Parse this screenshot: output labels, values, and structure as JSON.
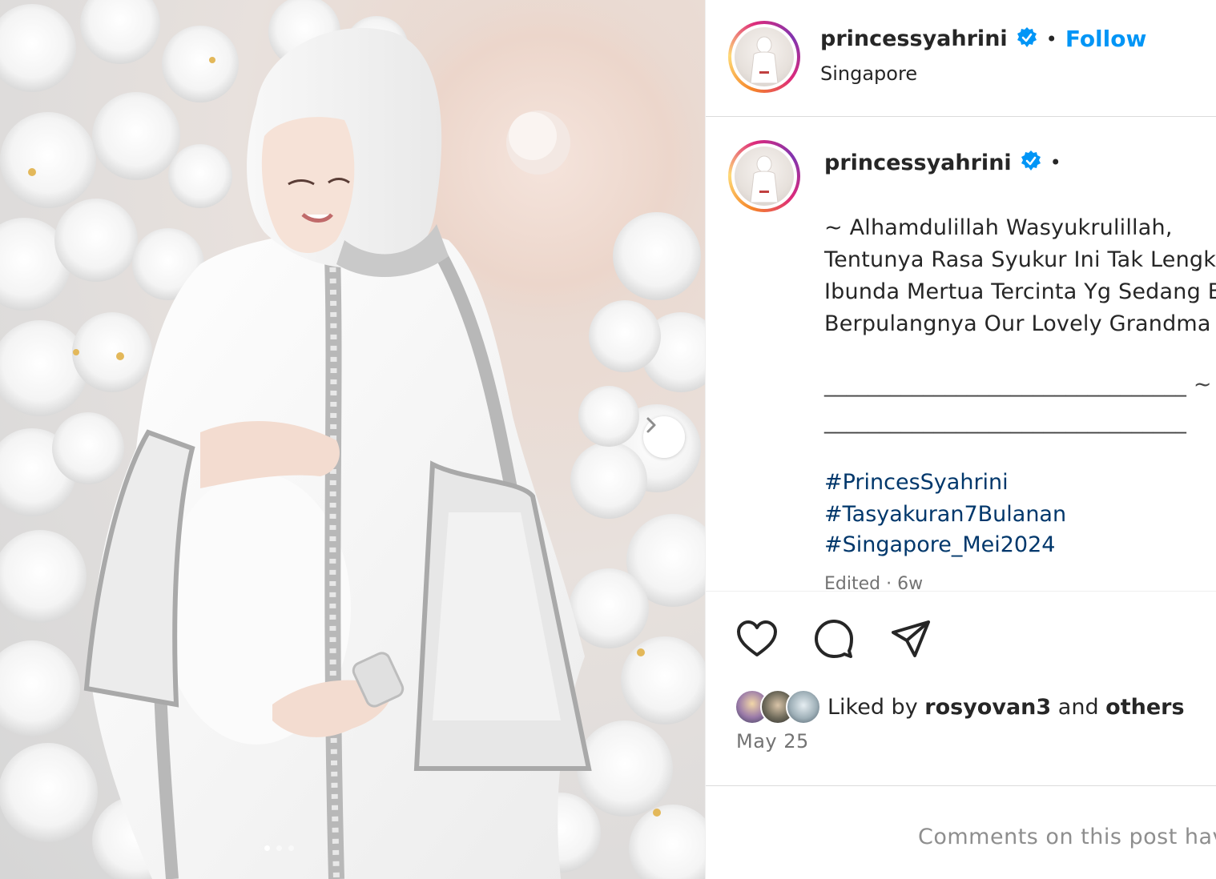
{
  "post": {
    "username": "princessyahrini",
    "bullet": "•",
    "follow_label": "Follow",
    "location": "Singapore"
  },
  "caption": {
    "username": "princessyahrini",
    "bullet": "•",
    "lines": [
      "~ Alhamdulillah Wasyukrulillah,",
      "Tentunya Rasa Syukur Ini Tak Lengka",
      "Ibunda Mertua Tercinta Yg Sedang B",
      "Berpulangnya Our Lovely Grandma K",
      "_________________________________ ~",
      "_________________________________"
    ],
    "hashtags": [
      "#PrincesSyahrini",
      "#Tasyakuran7Bulanan",
      "#Singapore_Mei2024"
    ],
    "edited": "Edited · 6w"
  },
  "actions": {
    "icons": [
      "heart-icon",
      "comment-icon",
      "share-icon"
    ]
  },
  "likes": {
    "prefix": "Liked by",
    "user": "rosyovan3",
    "conjunction": "and",
    "others": "others"
  },
  "date": "May 25",
  "comments_notice": "Comments on this post hav",
  "colors": {
    "follow_blue": "#0095f6",
    "hashtag_blue": "#00376b",
    "verified_blue": "#0095f6",
    "muted_gray": "#737373"
  }
}
